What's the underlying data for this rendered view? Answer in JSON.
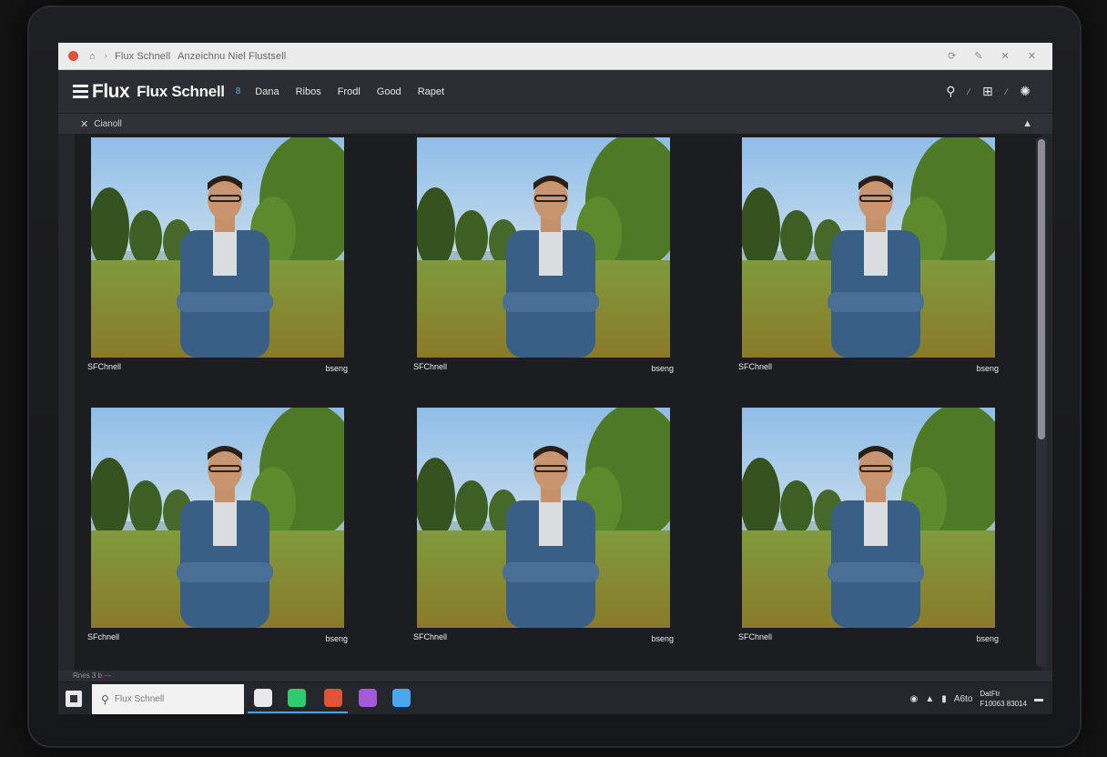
{
  "browser": {
    "title": "Flux Schnell",
    "address_text": "Anzeichnu  Niel Flustsell",
    "home_glyph": "⌂",
    "arrow_glyph": "›",
    "right_icons": [
      "⟳",
      "✎",
      "✕",
      "✕"
    ]
  },
  "app": {
    "logo_word": "Flux",
    "logo_sub": "Flux Schnell",
    "badge": "8",
    "nav": [
      "Dana",
      "Ribos",
      "Frodl",
      "Good",
      "Rapet"
    ],
    "right_glyphs": {
      "search": "⚲",
      "sep1": "⁄",
      "media": "⊞",
      "sep2": "⁄",
      "settings": "✺"
    }
  },
  "panel": {
    "icon": "✕",
    "title": "Cianoll",
    "collapse": "▲"
  },
  "gallery": {
    "items": [
      {
        "name": "SFChnell",
        "format": "bseng"
      },
      {
        "name": "SFChnell",
        "format": "bseng"
      },
      {
        "name": "SFChnell",
        "format": "bseng"
      },
      {
        "name": "SFchnell",
        "format": "bseng"
      },
      {
        "name": "SFChnell",
        "format": "bseng"
      },
      {
        "name": "SFChnell",
        "format": "bseng"
      }
    ]
  },
  "status": {
    "text": "Rnes 3 b",
    "highlight": "—"
  },
  "taskbar": {
    "search_placeholder": "Flux Schnell",
    "search_glyph": "⚲",
    "apps": [
      {
        "name": "app-store",
        "color": "#e9e9e9"
      },
      {
        "name": "messages",
        "color": "#2ecc71"
      },
      {
        "name": "photos",
        "color": "#e0533b"
      },
      {
        "name": "gallery",
        "color": "#a35bd6"
      },
      {
        "name": "explorer",
        "color": "#4aa8ea"
      }
    ],
    "tray_glyphs": [
      "◉",
      "▲",
      "▮"
    ],
    "tray_text": "A6to",
    "clock_time": "DatFtr",
    "clock_date": "F10063  83014",
    "battery_glyph": "▬"
  }
}
